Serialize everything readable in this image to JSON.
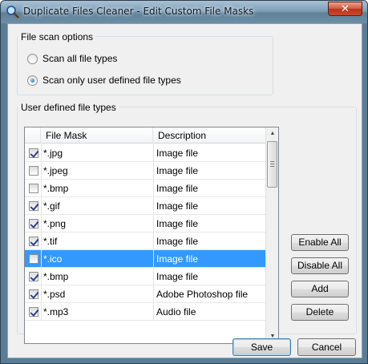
{
  "window": {
    "title": "Duplicate Files Cleaner - Edit Custom File Masks",
    "close_label": "✕",
    "app_icon": "magnifier-icon"
  },
  "scan_options": {
    "group_label": "File scan options",
    "radio_all": {
      "label": "Scan all file types",
      "checked": false
    },
    "radio_user": {
      "label": "Scan only user defined file types",
      "checked": true
    }
  },
  "file_types": {
    "group_label": "User defined file types",
    "columns": [
      "File Mask",
      "Description"
    ],
    "rows": [
      {
        "checked": true,
        "mask": "*.jpg",
        "description": "Image file",
        "selected": false
      },
      {
        "checked": false,
        "mask": "*.jpeg",
        "description": "Image file",
        "selected": false
      },
      {
        "checked": false,
        "mask": "*.bmp",
        "description": "Image file",
        "selected": false
      },
      {
        "checked": true,
        "mask": "*.gif",
        "description": "Image file",
        "selected": false
      },
      {
        "checked": true,
        "mask": "*.png",
        "description": "Image file",
        "selected": false
      },
      {
        "checked": true,
        "mask": "*.tif",
        "description": "Image file",
        "selected": false
      },
      {
        "checked": false,
        "mask": "*.ico",
        "description": "Image file",
        "selected": true
      },
      {
        "checked": true,
        "mask": "*.bmp",
        "description": "Image file",
        "selected": false
      },
      {
        "checked": true,
        "mask": "*.psd",
        "description": "Adobe Photoshop file",
        "selected": false
      },
      {
        "checked": true,
        "mask": "*.mp3",
        "description": "Audio file",
        "selected": false
      }
    ]
  },
  "buttons": {
    "enable_all": "Enable All",
    "disable_all": "Disable All",
    "add": "Add",
    "delete": "Delete",
    "save": "Save",
    "cancel": "Cancel"
  },
  "colors": {
    "selection": "#3399ff",
    "frame": "#5a7d94"
  }
}
